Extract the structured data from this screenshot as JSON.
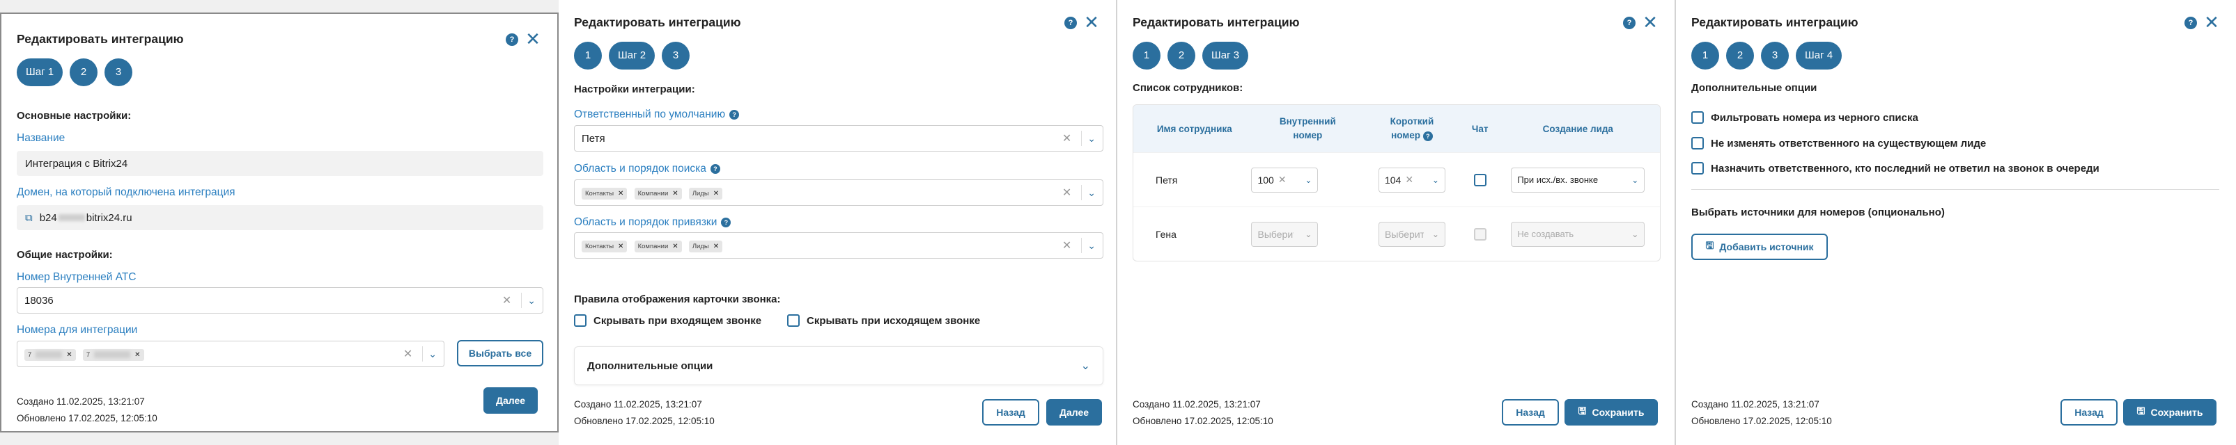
{
  "dialog_title": "Редактировать интеграцию",
  "help_glyph": "?",
  "close_glyph": "✕",
  "colors": {
    "accent": "#2b6f9e",
    "link": "#2b7fc0"
  },
  "footer": {
    "created": "Создано 11.02.2025, 13:21:07",
    "updated": "Обновлено 17.02.2025, 12:05:10"
  },
  "buttons": {
    "next": "Далее",
    "back": "Назад",
    "save": "Сохранить",
    "select_all": "Выбрать все",
    "add_source": "Добавить источник"
  },
  "step1": {
    "steps": [
      "Шаг 1",
      "2",
      "3"
    ],
    "main_settings": "Основные настройки:",
    "name_label": "Название",
    "name_value": "Интеграция с Bitrix24",
    "domain_label": "Домен, на который подключена интеграция",
    "domain_prefix": "b24",
    "domain_suffix": "bitrix24.ru",
    "common_settings": "Общие настройки:",
    "pbx_label": "Номер Внутренней АТС",
    "pbx_value": "18036",
    "numbers_label": "Номера для интеграции",
    "number_chips": [
      "7",
      "7"
    ]
  },
  "step2": {
    "steps": [
      "1",
      "Шаг 2",
      "3"
    ],
    "integration_settings": "Настройки интеграции:",
    "responsible_label": "Ответственный по умолчанию",
    "responsible_value": "Петя",
    "search_label": "Область и порядок поиска",
    "search_chips": [
      "Контакты",
      "Компании",
      "Лиды"
    ],
    "binding_label": "Область и порядок привязки",
    "binding_chips": [
      "Контакты",
      "Компании",
      "Лиды"
    ],
    "card_rules": "Правила отображения карточки звонка:",
    "hide_incoming": "Скрывать при входящем звонке",
    "hide_outgoing": "Скрывать при исходящем звонке",
    "additional_options": "Дополнительные опции"
  },
  "step3": {
    "steps": [
      "1",
      "2",
      "Шаг 3"
    ],
    "employees_list": "Список сотрудников:",
    "columns": {
      "name": "Имя сотрудника",
      "internal_1": "Внутренний",
      "internal_2": "номер",
      "short_1": "Короткий",
      "short_2": "номер",
      "chat": "Чат",
      "lead": "Создание лида"
    },
    "rows": [
      {
        "name": "Петя",
        "internal": "100",
        "short": "104",
        "lead": "При исх./вх. звонке"
      },
      {
        "name": "Гена",
        "internal": "Выберите",
        "short": "Выберите",
        "lead": "Не создавать"
      }
    ]
  },
  "step4": {
    "steps": [
      "1",
      "2",
      "3",
      "Шаг 4"
    ],
    "additional_options": "Дополнительные опции",
    "options": [
      "Фильтровать номера из черного списка",
      "Не изменять ответственного на существующем лиде",
      "Назначить ответственного, кто последний не ответил на звонок в очереди"
    ],
    "sources_title": "Выбрать источники для номеров (опционально)"
  }
}
